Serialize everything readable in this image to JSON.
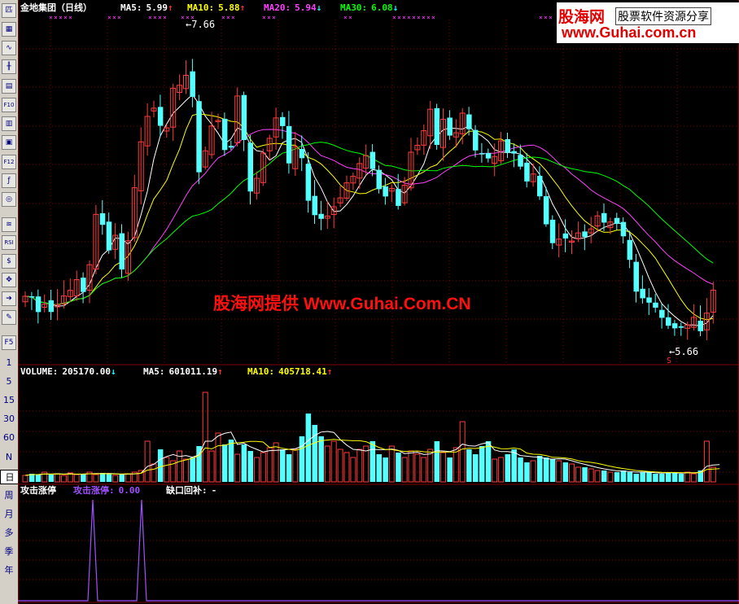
{
  "toolbar": {
    "icons": [
      "k-line-icon",
      "table-icon",
      "trend-icon",
      "candle-icon",
      "news-icon",
      "f10-icon",
      "info-icon",
      "finance-icon",
      "f12-icon",
      "formula-icon",
      "search-icon",
      "indicator-icon",
      "rsi-icon",
      "money-icon",
      "move-icon",
      "enter-icon",
      "pen-icon",
      "f5-icon"
    ],
    "icon_glyphs": [
      "匹",
      "▦",
      "∿",
      "╫",
      "▤",
      "F10",
      "▥",
      "▣",
      "F12",
      "ƒ",
      "◎",
      "≋",
      "RSI",
      "$",
      "✥",
      "➔",
      "✎",
      "F5"
    ],
    "periods": [
      "1",
      "5",
      "15",
      "30",
      "60",
      "N",
      "日",
      "周",
      "月",
      "多",
      "季",
      "年"
    ],
    "selected_period": "日"
  },
  "header": {
    "stock": "金地集团（日线）",
    "ma5_label": "MA5:",
    "ma5_value": "5.99",
    "ma10_label": "MA10:",
    "ma10_value": "5.88",
    "ma20_label": "MA20:",
    "ma20_value": "5.94",
    "ma30_label": "MA30:",
    "ma30_value": "6.08",
    "ma5_arrow": "↑",
    "ma10_arrow": "↑",
    "ma20_arrow": "↓",
    "ma30_arrow": "↓"
  },
  "price_panel": {
    "max_label": "7.66",
    "min_label": "5.66",
    "s_marker": "S",
    "watermark": "股海网提供 Www.Guhai.Com.CN"
  },
  "volume_panel": {
    "volume_label": "VOLUME:",
    "volume_value": "205170.00",
    "ma5_label": "MA5:",
    "ma5_value": "601011.19",
    "ma10_label": "MA10:",
    "ma10_value": "405718.41",
    "volume_arrow": "↓",
    "ma5_arrow": "↑",
    "ma10_arrow": "↑"
  },
  "indicator_panel": {
    "name": "攻击涨停",
    "line_label": "攻击涨停:",
    "line_value": "0.00",
    "gap_label": "缺口回补:",
    "gap_value": "-"
  },
  "logo": {
    "brand": "股海网",
    "slogan": "股票软件资源分享",
    "url": "www.Guhai.com.cn"
  },
  "colors": {
    "up": "#ff3c3c",
    "down": "#54ffff",
    "ma5": "#ffffff",
    "ma10": "#ffff00",
    "ma20": "#ff40ff",
    "ma30": "#00ff00",
    "grid": "#800000",
    "indicator": "#a050ff"
  }
}
